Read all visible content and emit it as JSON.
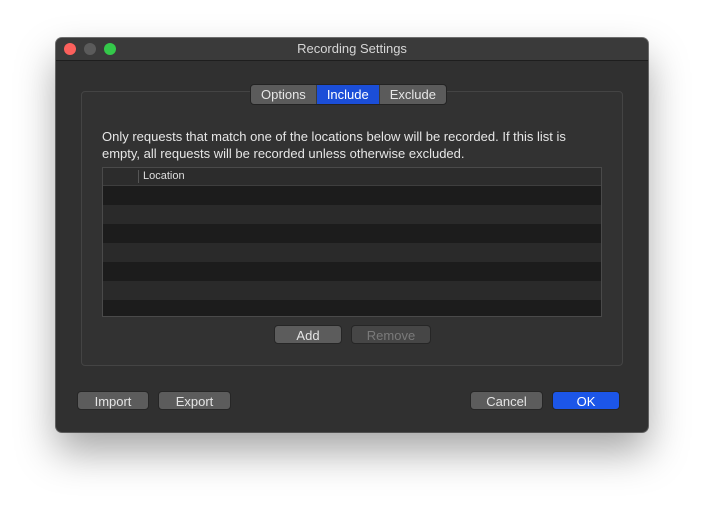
{
  "window": {
    "title": "Recording Settings"
  },
  "tabs": [
    {
      "label": "Options",
      "active": false
    },
    {
      "label": "Include",
      "active": true
    },
    {
      "label": "Exclude",
      "active": false
    }
  ],
  "include": {
    "description": "Only requests that match one of the locations below will be recorded. If this list is empty, all requests will be recorded unless otherwise excluded.",
    "table": {
      "columns": [
        "Location"
      ],
      "rows": []
    },
    "add_label": "Add",
    "remove_label": "Remove"
  },
  "footer": {
    "import_label": "Import",
    "export_label": "Export",
    "cancel_label": "Cancel",
    "ok_label": "OK"
  },
  "colors": {
    "accent": "#1b4ed8",
    "close": "#fc605c",
    "maximize": "#34c84a",
    "window_bg": "#303030"
  }
}
